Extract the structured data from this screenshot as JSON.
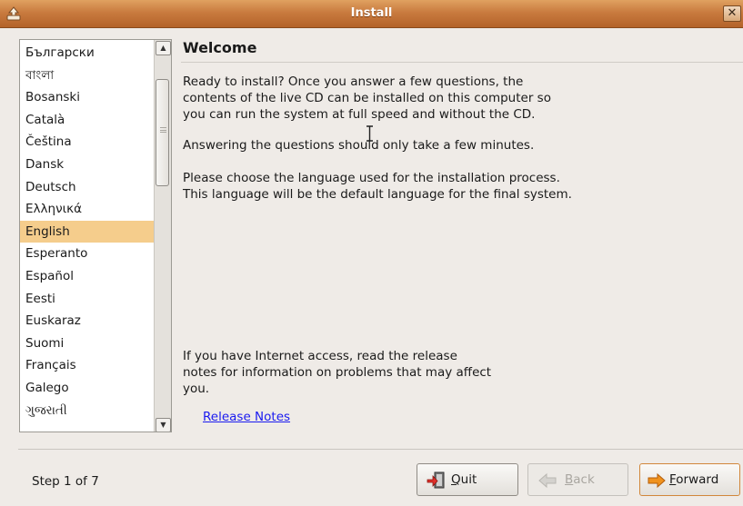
{
  "window": {
    "title": "Install"
  },
  "languages": {
    "items": [
      "Български",
      "বাংলা",
      "Bosanski",
      "Català",
      "Čeština",
      "Dansk",
      "Deutsch",
      "Ελληνικά",
      "English",
      "Esperanto",
      "Español",
      "Eesti",
      "Euskaraz",
      "Suomi",
      "Français",
      "Galego",
      "ગુજરાતી"
    ],
    "selected": "English"
  },
  "content": {
    "heading": "Welcome",
    "paragraph_1_line_1": "Ready to install? Once you answer a few questions, the",
    "paragraph_1_line_2": "contents of the live CD can be installed on this computer so",
    "paragraph_1_line_3": "you can run the system at full speed and without the CD.",
    "paragraph_2": "Answering the questions should only take a few minutes.",
    "paragraph_3_line_1": "Please choose the language used for the installation process.",
    "paragraph_3_line_2": "This language will be the default language for the final system.",
    "paragraph_4_line_1": "If you have Internet access, read the release",
    "paragraph_4_line_2": "notes for information on problems that may affect",
    "paragraph_4_line_3": "you.",
    "release_notes_link": "Release Notes"
  },
  "footer": {
    "step": "Step 1 of 7",
    "quit_label_mnemonic": "Q",
    "quit_label_rest": "uit",
    "back_label_mnemonic": "B",
    "back_label_rest": "ack",
    "forward_label_mnemonic": "F",
    "forward_label_rest": "orward"
  },
  "icons": {
    "app": "installer-icon",
    "close": "close-icon",
    "quit": "quit-icon",
    "back": "back-arrow-icon",
    "forward": "forward-arrow-icon"
  },
  "colors": {
    "titlebar": "#c97b3f",
    "selection": "#f5cd8c",
    "link": "#1a1af0",
    "forward_arrow": "#f0921e"
  }
}
